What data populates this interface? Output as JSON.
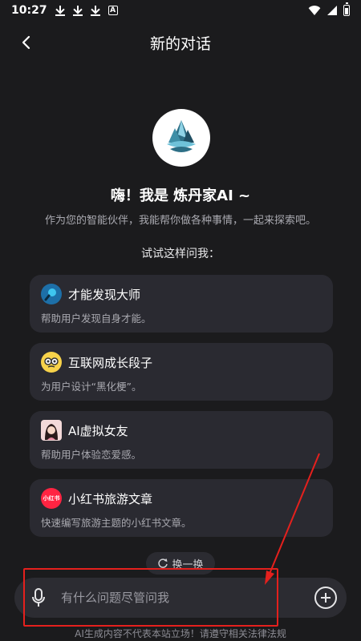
{
  "status_bar": {
    "time": "10:27"
  },
  "header": {
    "title": "新的对话"
  },
  "intro": {
    "greeting": "嗨！我是 炼丹家AI ~",
    "subtitle": "作为您的智能伙伴，我能帮你做各种事情，一起来探索吧。",
    "try_label": "试试这样问我："
  },
  "suggestions": [
    {
      "title": "才能发现大师",
      "desc": "帮助用户发现自身才能。",
      "icon": "magnifier-icon"
    },
    {
      "title": "互联网成长段子",
      "desc": "为用户设计“黑化梗”。",
      "icon": "glasses-face-icon"
    },
    {
      "title": "AI虚拟女友",
      "desc": "帮助用户体验恋爱感。",
      "icon": "girl-avatar-icon"
    },
    {
      "title": "小红书旅游文章",
      "desc": "快速编写旅游主题的小红书文章。",
      "icon": "xiaohongshu-logo-icon",
      "icon_text": "小红书"
    }
  ],
  "refresh": {
    "label": "换一换"
  },
  "input": {
    "placeholder": "有什么问题尽管问我"
  },
  "footer": {
    "disclaimer": "AI生成内容不代表本站立场！请遵守相关法律法规"
  },
  "colors": {
    "background": "#1b1b1d",
    "card": "#2a2a31",
    "annotation": "#e5201d",
    "xhs_red": "#ff2442"
  }
}
